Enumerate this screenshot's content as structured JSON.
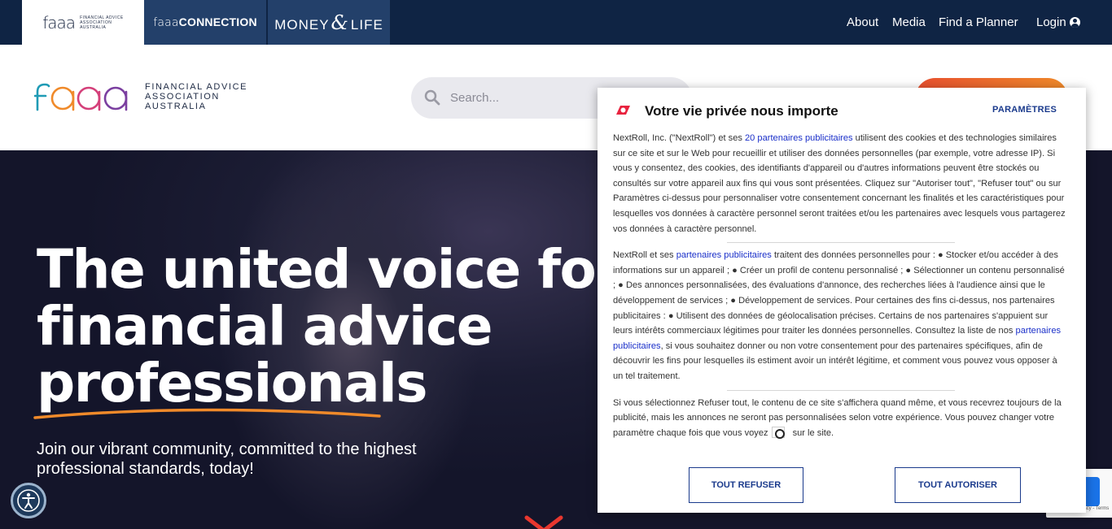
{
  "topbar": {
    "tab_faaa": {
      "word": "faaa",
      "sub": [
        "FINANCIAL ADVICE",
        "ASSOCIATION",
        "AUSTRALIA"
      ]
    },
    "tab_connection": {
      "light": "faaa",
      "bold": "CONNECTION"
    },
    "tab_money": {
      "left": "MONEY",
      "amp": "&",
      "right": "LIFE"
    },
    "nav": {
      "about": "About",
      "media": "Media",
      "planner": "Find a Planner",
      "login": "Login"
    }
  },
  "header": {
    "logo_word": "faaa",
    "logo_sub": [
      "FINANCIAL ADVICE",
      "ASSOCIATION",
      "AUSTRALIA"
    ],
    "search_placeholder": "Search..."
  },
  "hero": {
    "title_lines": [
      "The united voice for",
      "financial advice",
      "professionals"
    ],
    "subtitle": "Join our vibrant community, committed to the highest professional standards, today!"
  },
  "cookie": {
    "title": "Votre vie privée nous importe",
    "settings": "PARAMÈTRES",
    "p1_a": "NextRoll, Inc. (\"NextRoll\") et ses ",
    "p1_link": "20 partenaires publicitaires",
    "p1_b": " utilisent des cookies et des technologies similaires sur ce site et sur le Web pour recueillir et utiliser des données personnelles (par exemple, votre adresse IP). Si vous y consentez, des cookies, des identifiants d'appareil ou d'autres informations peuvent être stockés ou consultés sur votre appareil aux fins qui vous sont présentées. Cliquez sur \"Autoriser tout\", \"Refuser tout\" ou sur Paramètres ci-dessus pour personnaliser votre consentement concernant les finalités et les caractéristiques pour lesquelles vos données à caractère personnel seront traitées et/ou les partenaires avec lesquels vous partagerez vos données à caractère personnel.",
    "p2_a": "NextRoll et ses ",
    "p2_link1": "partenaires publicitaires",
    "p2_b": " traitent des données personnelles pour : ● Stocker et/ou accéder à des informations sur un appareil ; ● Créer un profil de contenu personnalisé ; ● Sélectionner un contenu personnalisé ; ● Des annonces personnalisées, des évaluations d'annonce, des recherches liées à l'audience ainsi que le développement de services ; ● Développement de services. Pour certaines des fins ci-dessus, nos partenaires publicitaires : ● Utilisent des données de géolocalisation précises. Certains de nos partenaires s'appuient sur leurs intérêts commerciaux légitimes pour traiter les données personnelles. Consultez la liste de nos ",
    "p2_link2": "partenaires publicitaires",
    "p2_c": ", si vous souhaitez donner ou non votre consentement pour des partenaires spécifiques, afin de découvrir les fins pour lesquelles ils estiment avoir un intérêt légitime, et comment vous pouvez vous opposer à un tel traitement.",
    "p3_a": "Si vous sélectionnez Refuser tout, le contenu de ce site s'affichera quand même, et vous recevrez toujours de la publicité, mais les annonces ne seront pas personnalisées selon votre expérience. Vous pouvez changer votre paramètre chaque fois que vous voyez",
    "p3_b": "sur le site.",
    "btn_refuse": "TOUT REFUSER",
    "btn_accept": "TOUT AUTORISER"
  },
  "recaptcha_text": "Privacy - Terms",
  "colors": {
    "navy": "#0f2444",
    "tab_blue": "#23406a",
    "logo_orange": "#f08a2a",
    "logo_purple": "#7b3fa0",
    "link_blue": "#1a2fc9",
    "cta_orange": "#e8502f"
  }
}
